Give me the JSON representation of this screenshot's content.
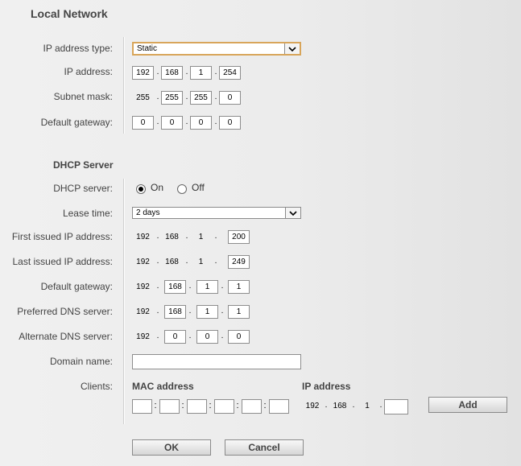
{
  "title": "Local Network",
  "labels": {
    "ip_type": "IP address type:",
    "ip_address": "IP address:",
    "subnet": "Subnet mask:",
    "gateway": "Default gateway:",
    "dhcp_section": "DHCP Server",
    "dhcp_server": "DHCP server:",
    "lease": "Lease time:",
    "first_ip": "First issued IP address:",
    "last_ip": "Last issued IP address:",
    "dhcp_gateway": "Default gateway:",
    "pref_dns": "Preferred DNS server:",
    "alt_dns": "Alternate DNS server:",
    "domain": "Domain name:",
    "clients": "Clients:"
  },
  "ip_type_value": "Static",
  "ip_address": [
    "192",
    "168",
    "1",
    "254"
  ],
  "subnet": [
    "255",
    "255",
    "255",
    "0"
  ],
  "gateway": [
    "0",
    "0",
    "0",
    "0"
  ],
  "dhcp": {
    "on_label": "On",
    "off_label": "Off",
    "selected": "On",
    "lease_value": "2 days",
    "first_ip": [
      "192",
      "168",
      "1",
      "200"
    ],
    "last_ip": [
      "192",
      "168",
      "1",
      "249"
    ],
    "gateway": [
      "192",
      "168",
      "1",
      "1"
    ],
    "pref_dns": [
      "192",
      "168",
      "1",
      "1"
    ],
    "alt_dns": [
      "192",
      "0",
      "0",
      "0"
    ],
    "domain_name": ""
  },
  "clients": {
    "mac_header": "MAC address",
    "ip_header": "IP address",
    "ip_prefix": [
      "192",
      "168",
      "1"
    ],
    "ip_last": "",
    "add_label": "Add"
  },
  "buttons": {
    "ok": "OK",
    "cancel": "Cancel"
  },
  "icons": {
    "dropdown": "chevron-down-icon"
  }
}
